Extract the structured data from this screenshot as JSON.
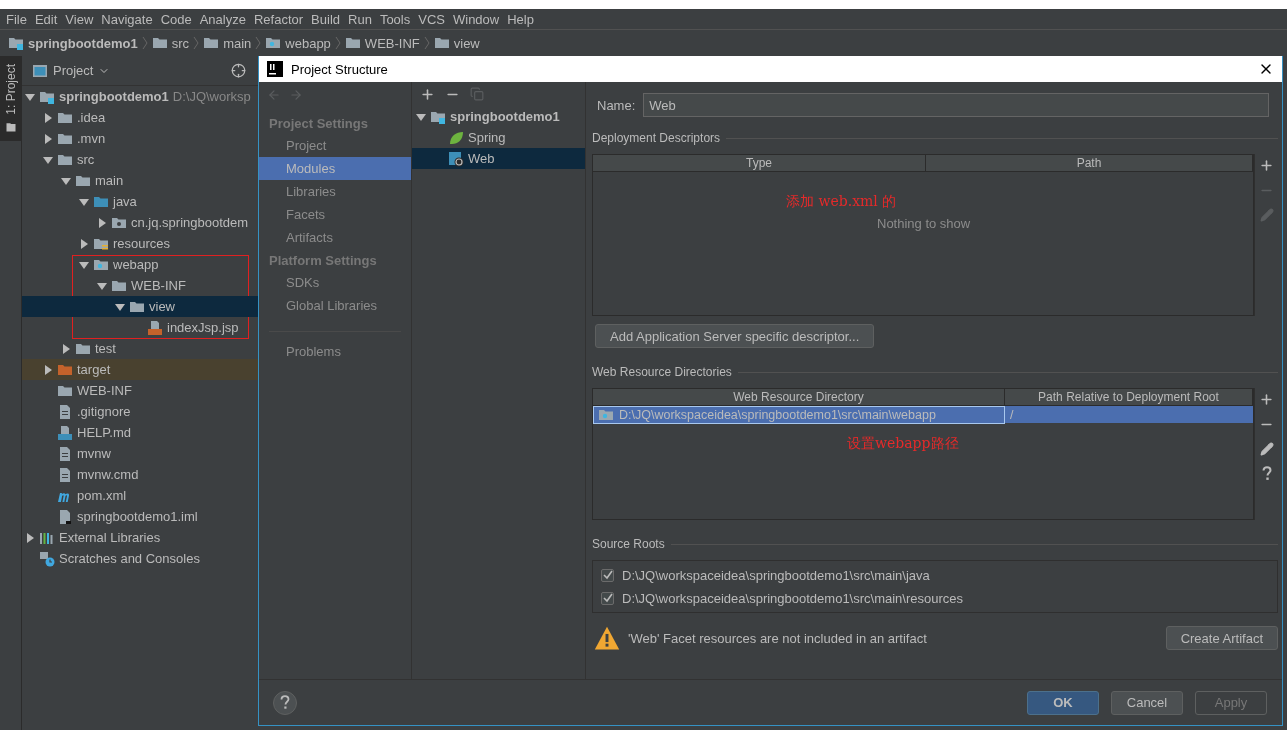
{
  "menu": [
    "File",
    "Edit",
    "View",
    "Navigate",
    "Code",
    "Analyze",
    "Refactor",
    "Build",
    "Run",
    "Tools",
    "VCS",
    "Window",
    "Help"
  ],
  "breadcrumbs": [
    {
      "label": "springbootdemo1",
      "kind": "module"
    },
    {
      "label": "src",
      "kind": "folder"
    },
    {
      "label": "main",
      "kind": "folder"
    },
    {
      "label": "webapp",
      "kind": "web-folder"
    },
    {
      "label": "WEB-INF",
      "kind": "folder"
    },
    {
      "label": "view",
      "kind": "folder"
    }
  ],
  "tool_window_tab": {
    "label": "1: Project",
    "selected": true
  },
  "project_panel": {
    "title": "Project",
    "tree": [
      {
        "label": "springbootdemo1",
        "hint": "D:\\JQ\\worksp",
        "kind": "module",
        "expanded": true,
        "selected": false,
        "children": [
          {
            "label": ".idea",
            "kind": "folder",
            "expanded": false,
            "selected": false
          },
          {
            "label": ".mvn",
            "kind": "folder",
            "expanded": false,
            "selected": false
          },
          {
            "label": "src",
            "kind": "folder",
            "expanded": true,
            "selected": false,
            "children": [
              {
                "label": "main",
                "kind": "folder",
                "expanded": true,
                "selected": false,
                "children": [
                  {
                    "label": "java",
                    "kind": "source-folder",
                    "expanded": true,
                    "selected": false,
                    "children": [
                      {
                        "label": "cn.jq.springbootdem",
                        "kind": "package",
                        "expanded": false,
                        "selected": false
                      }
                    ]
                  },
                  {
                    "label": "resources",
                    "kind": "resources-folder",
                    "expanded": false,
                    "selected": false
                  },
                  {
                    "label": "webapp",
                    "kind": "web-folder",
                    "expanded": true,
                    "selected": false,
                    "children": [
                      {
                        "label": "WEB-INF",
                        "kind": "folder",
                        "expanded": true,
                        "selected": false,
                        "children": [
                          {
                            "label": "view",
                            "kind": "folder",
                            "expanded": true,
                            "selected": true,
                            "children": [
                              {
                                "label": "indexJsp.jsp",
                                "kind": "jsp",
                                "selected": false
                              }
                            ]
                          }
                        ]
                      }
                    ]
                  }
                ]
              },
              {
                "label": "test",
                "kind": "folder",
                "expanded": false,
                "selected": false
              }
            ]
          },
          {
            "label": "target",
            "kind": "excluded-folder",
            "expanded": false,
            "selected": false
          },
          {
            "label": "WEB-INF",
            "kind": "folder",
            "selected": false
          },
          {
            "label": ".gitignore",
            "kind": "text-file",
            "selected": false
          },
          {
            "label": "HELP.md",
            "kind": "md-file",
            "selected": false
          },
          {
            "label": "mvnw",
            "kind": "text-file",
            "selected": false
          },
          {
            "label": "mvnw.cmd",
            "kind": "text-file",
            "selected": false
          },
          {
            "label": "pom.xml",
            "kind": "maven-file",
            "selected": false
          },
          {
            "label": "springbootdemo1.iml",
            "kind": "iml-file",
            "selected": false
          }
        ]
      },
      {
        "label": "External Libraries",
        "kind": "libraries",
        "expanded": false,
        "selected": false
      },
      {
        "label": "Scratches and Consoles",
        "kind": "scratches",
        "selected": false
      }
    ]
  },
  "dialog": {
    "title": "Project Structure",
    "nav": [
      {
        "heading": "Project Settings",
        "items": [
          {
            "label": "Project",
            "selected": false
          },
          {
            "label": "Modules",
            "selected": true
          },
          {
            "label": "Libraries",
            "selected": false
          },
          {
            "label": "Facets",
            "selected": false
          },
          {
            "label": "Artifacts",
            "selected": false
          }
        ]
      },
      {
        "heading": "Platform Settings",
        "items": [
          {
            "label": "SDKs",
            "selected": false
          },
          {
            "label": "Global Libraries",
            "selected": false
          }
        ]
      }
    ],
    "nav_extra": [
      {
        "label": "Problems",
        "selected": false
      }
    ],
    "module_tools": [
      {
        "kind": "add",
        "disabled": false
      },
      {
        "kind": "remove",
        "disabled": false
      },
      {
        "kind": "copy",
        "disabled": true
      }
    ],
    "module_tree": [
      {
        "label": "springbootdemo1",
        "kind": "module",
        "expanded": true,
        "selected": false,
        "children": [
          {
            "label": "Spring",
            "kind": "spring",
            "selected": false
          },
          {
            "label": "Web",
            "kind": "web",
            "selected": true
          }
        ]
      }
    ],
    "name_field": {
      "label": "Name:",
      "value": "Web"
    },
    "deployment_descriptors": {
      "title": "Deployment Descriptors",
      "columns": [
        "Type",
        "Path"
      ],
      "empty_text": "Nothing to show",
      "annotation": "添加 web.xml 的",
      "tools": [
        {
          "kind": "add",
          "disabled": false
        },
        {
          "kind": "remove",
          "disabled": true
        },
        {
          "kind": "edit",
          "disabled": true
        }
      ],
      "button": "Add Application Server specific descriptor..."
    },
    "web_resource_directories": {
      "title": "Web Resource Directories",
      "columns": [
        "Web Resource Directory",
        "Path Relative to Deployment Root"
      ],
      "rows": [
        {
          "directory": "D:\\JQ\\workspaceidea\\springbootdemo1\\src\\main\\webapp",
          "path": "/",
          "selected": true
        }
      ],
      "annotation": "设置webapp路径",
      "tools": [
        {
          "kind": "add",
          "disabled": false
        },
        {
          "kind": "remove",
          "disabled": false
        },
        {
          "kind": "edit",
          "disabled": false
        },
        {
          "kind": "help",
          "disabled": false
        }
      ]
    },
    "source_roots": {
      "title": "Source Roots",
      "items": [
        {
          "path": "D:\\JQ\\workspaceidea\\springbootdemo1\\src\\main\\java",
          "checked": true
        },
        {
          "path": "D:\\JQ\\workspaceidea\\springbootdemo1\\src\\main\\resources",
          "checked": true
        }
      ]
    },
    "warning": {
      "text": "'Web' Facet resources are not included in an artifact",
      "button": "Create Artifact"
    },
    "buttons": [
      {
        "label": "OK",
        "kind": "default",
        "disabled": false
      },
      {
        "label": "Cancel",
        "kind": "normal",
        "disabled": false
      },
      {
        "label": "Apply",
        "kind": "normal",
        "disabled": true
      }
    ]
  }
}
